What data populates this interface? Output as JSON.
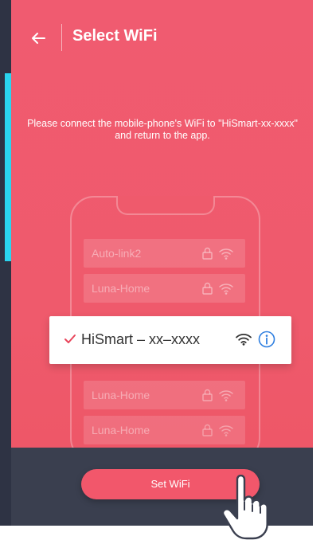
{
  "header": {
    "title": "Select WiFi",
    "back_icon": "arrow-left-icon"
  },
  "instruction": "Please connect the mobile-phone's WiFi to \"HiSmart-xx-xxxx\" and return to the app.",
  "networks": [
    {
      "name": "Auto-link2",
      "locked": true
    },
    {
      "name": "Luna-Home",
      "locked": true
    },
    {
      "name": "Luna-Home",
      "locked": true
    },
    {
      "name": "Luna-Home",
      "locked": true
    }
  ],
  "selected_network": {
    "name": "HiSmart – xx–xxxx",
    "icons": [
      "check-icon",
      "wifi-icon",
      "info-icon"
    ]
  },
  "bottom": {
    "button_label": "Set WiFi"
  },
  "colors": {
    "screen": "#ef5a6c",
    "bottom_bar": "#3a3f4f",
    "button": "#f2576b",
    "accent_blue": "#2f7fe0",
    "check": "#e8445a"
  }
}
